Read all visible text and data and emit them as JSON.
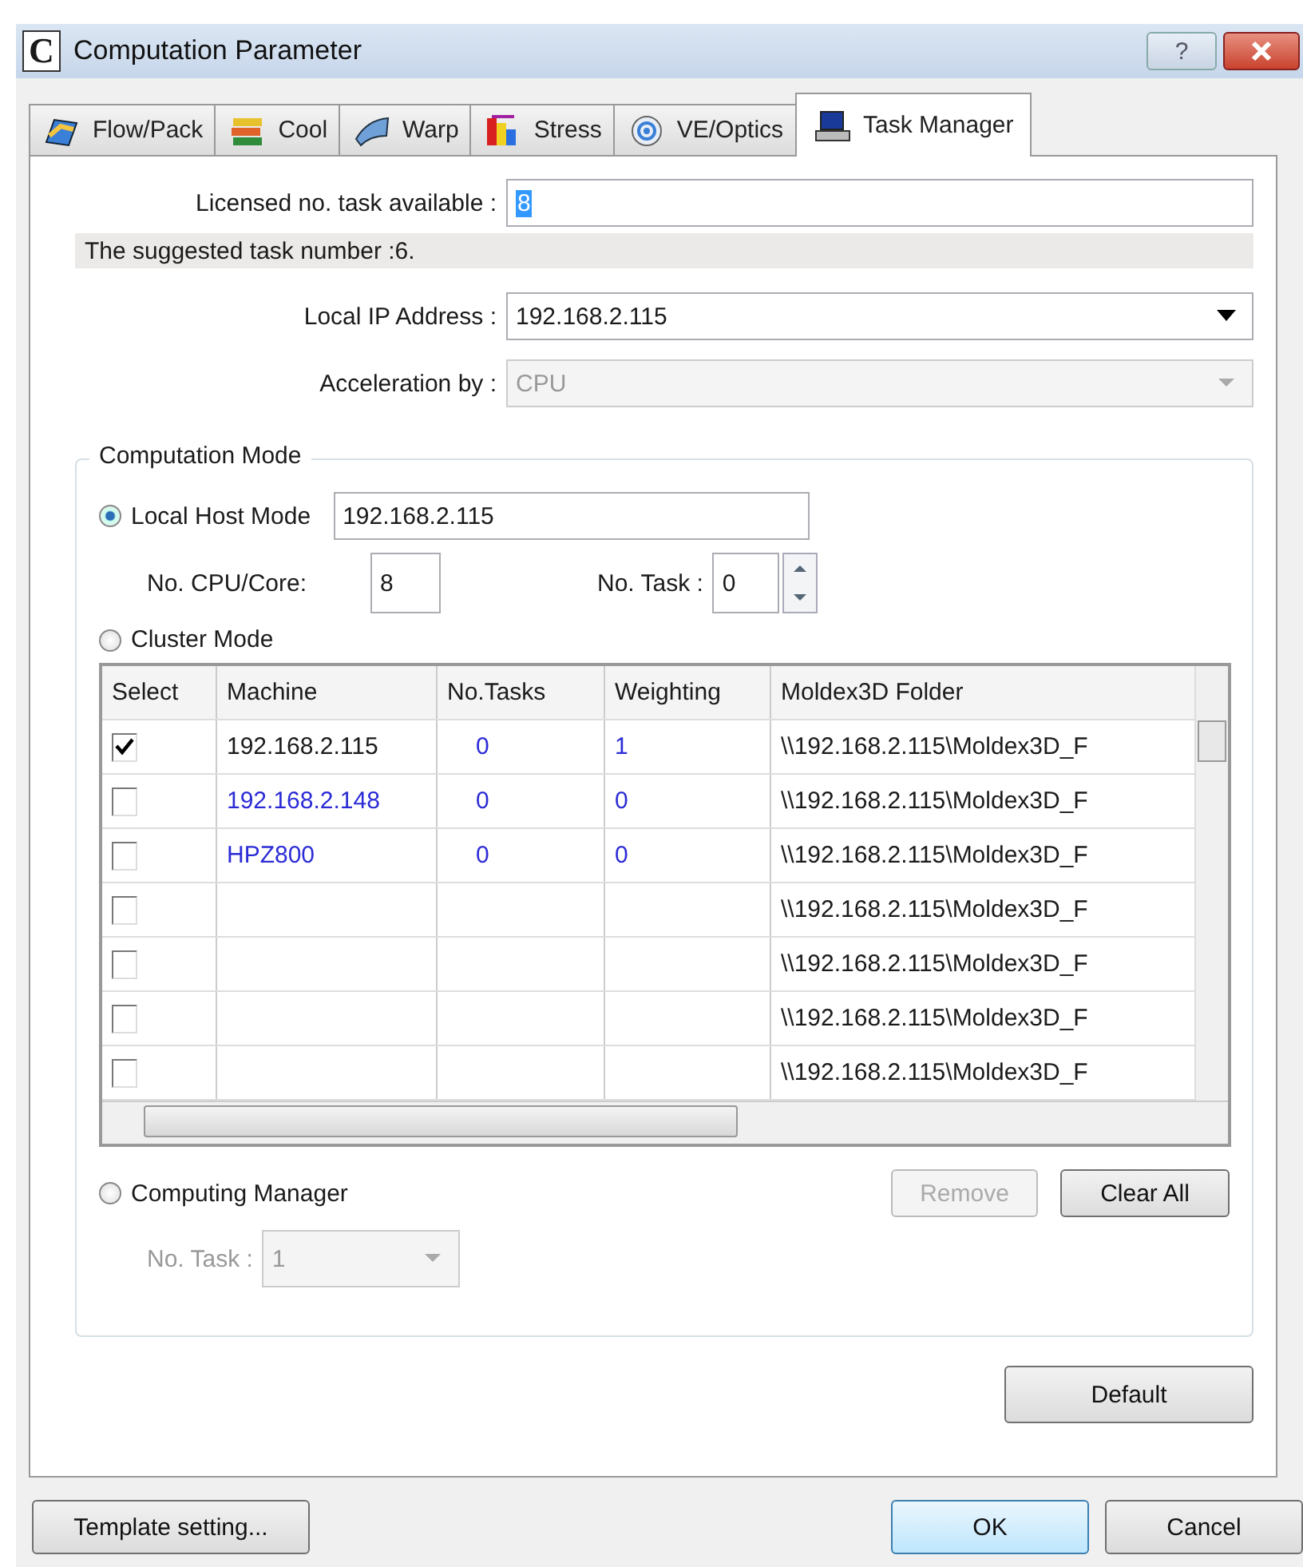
{
  "window": {
    "title": "Computation Parameter",
    "icon_letter": "C",
    "help": "?"
  },
  "tabs": [
    {
      "label": "Flow/Pack",
      "selected": false
    },
    {
      "label": "Cool",
      "selected": false
    },
    {
      "label": "Warp",
      "selected": false
    },
    {
      "label": "Stress",
      "selected": false
    },
    {
      "label": "VE/Optics",
      "selected": false
    },
    {
      "label": "Task Manager",
      "selected": true
    }
  ],
  "licensed": {
    "label": "Licensed no. task available :",
    "value": "8"
  },
  "suggestion": "The suggested task number :6.",
  "local_ip": {
    "label": "Local IP Address :",
    "value": "192.168.2.115",
    "disabled": false
  },
  "acceleration": {
    "label": "Acceleration by :",
    "value": "CPU",
    "disabled": true
  },
  "computation_mode": {
    "title": "Computation Mode",
    "local_host": {
      "label": "Local Host Mode",
      "selected": true,
      "value": "192.168.2.115"
    },
    "cpu_core": {
      "label": "No. CPU/Core:",
      "value": "8"
    },
    "no_task": {
      "label": "No. Task :",
      "value": "0"
    },
    "cluster": {
      "label": "Cluster Mode",
      "selected": false
    },
    "table": {
      "columns": [
        "Select",
        "Machine",
        "No.Tasks",
        "Weighting",
        "Moldex3D Folder"
      ],
      "rows": [
        {
          "checked": true,
          "machine": "192.168.2.115",
          "tasks": "0",
          "weighting": "1",
          "folder": "\\\\192.168.2.115\\Moldex3D_F",
          "color": "#1a1a1a"
        },
        {
          "checked": false,
          "machine": "192.168.2.148",
          "tasks": "0",
          "weighting": "0",
          "folder": "\\\\192.168.2.115\\Moldex3D_F",
          "color": "#2b2bd6"
        },
        {
          "checked": false,
          "machine": "HPZ800",
          "tasks": "0",
          "weighting": "0",
          "folder": "\\\\192.168.2.115\\Moldex3D_F",
          "color": "#2b2bd6"
        },
        {
          "checked": false,
          "folder": "\\\\192.168.2.115\\Moldex3D_F"
        },
        {
          "checked": false,
          "folder": "\\\\192.168.2.115\\Moldex3D_F"
        },
        {
          "checked": false,
          "folder": "\\\\192.168.2.115\\Moldex3D_F"
        },
        {
          "checked": false,
          "folder": "\\\\192.168.2.115\\Moldex3D_F"
        }
      ]
    },
    "computing_manager": {
      "label": "Computing Manager",
      "selected": false
    },
    "remove": {
      "label": "Remove",
      "disabled": true
    },
    "clear_all": {
      "label": "Clear All",
      "disabled": false
    },
    "manager_task": {
      "label": "No. Task :",
      "value": "1",
      "disabled": true
    }
  },
  "default_button": "Default",
  "buttons": {
    "template": "Template setting...",
    "ok": "OK",
    "cancel": "Cancel"
  }
}
